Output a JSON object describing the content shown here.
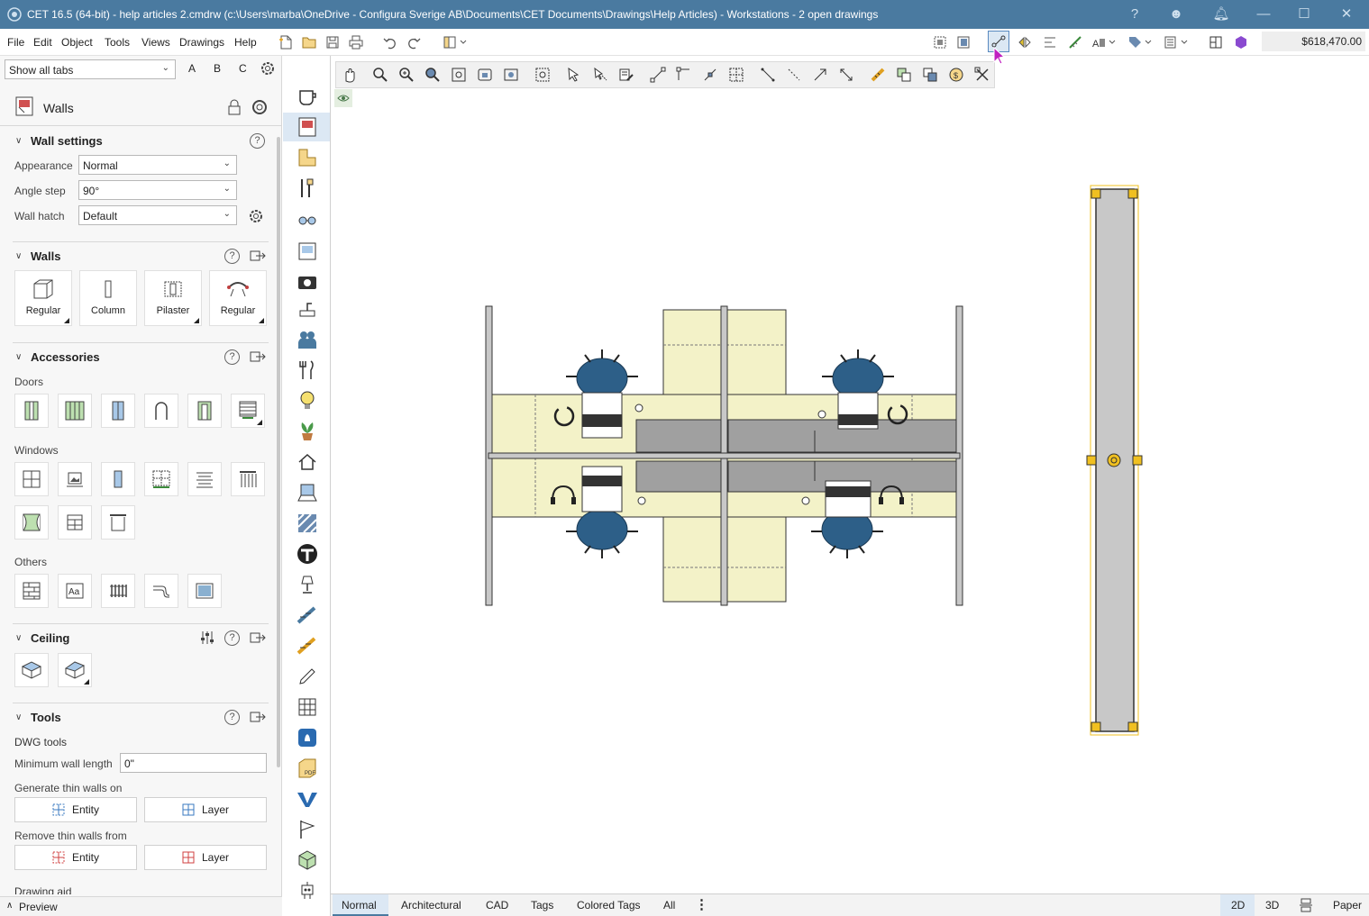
{
  "window": {
    "title": "CET 16.5 (64-bit) - help articles 2.cmdrw (c:\\Users\\marba\\OneDrive - Configura Sverige AB\\Documents\\CET Documents\\Drawings\\Help Articles) - Workstations - 2  open drawings"
  },
  "menu": [
    "File",
    "Edit",
    "Object",
    "Tools",
    "Views",
    "Drawings",
    "Help"
  ],
  "total_price": "$618,470.00",
  "tabfilter": {
    "value": "Show all tabs",
    "letters": [
      "A",
      "B",
      "C"
    ]
  },
  "panel": {
    "title": "Walls",
    "wall_settings": {
      "title": "Wall settings",
      "rows": [
        {
          "label": "Appearance",
          "value": "Normal"
        },
        {
          "label": "Angle step",
          "value": "90°"
        },
        {
          "label": "Wall hatch",
          "value": "Default"
        }
      ]
    },
    "walls": {
      "title": "Walls",
      "tiles": [
        "Regular",
        "Column",
        "Pilaster",
        "Regular"
      ]
    },
    "accessories": {
      "title": "Accessories",
      "doors": "Doors",
      "windows": "Windows",
      "others": "Others"
    },
    "ceiling": {
      "title": "Ceiling"
    },
    "tools": {
      "title": "Tools",
      "dwg": "DWG tools",
      "min_len_label": "Minimum wall length",
      "min_len_value": "0\"",
      "gen_label": "Generate thin walls on",
      "rem_label": "Remove thin walls from",
      "entity": "Entity",
      "layer": "Layer",
      "drawing_aid": "Drawing aid"
    },
    "preview": "Preview"
  },
  "bottom_tabs": [
    "Normal",
    "Architectural",
    "CAD",
    "Tags",
    "Colored Tags",
    "All"
  ],
  "view_modes": [
    "2D",
    "3D",
    "Paper"
  ],
  "colors": {
    "titlebar": "#4a7aa0",
    "desk": "#f3f2c8",
    "panel": "#c8c8c8",
    "chair": "#2d5f88",
    "selection": "#f0c020",
    "accent_active": "#dce8f4"
  }
}
